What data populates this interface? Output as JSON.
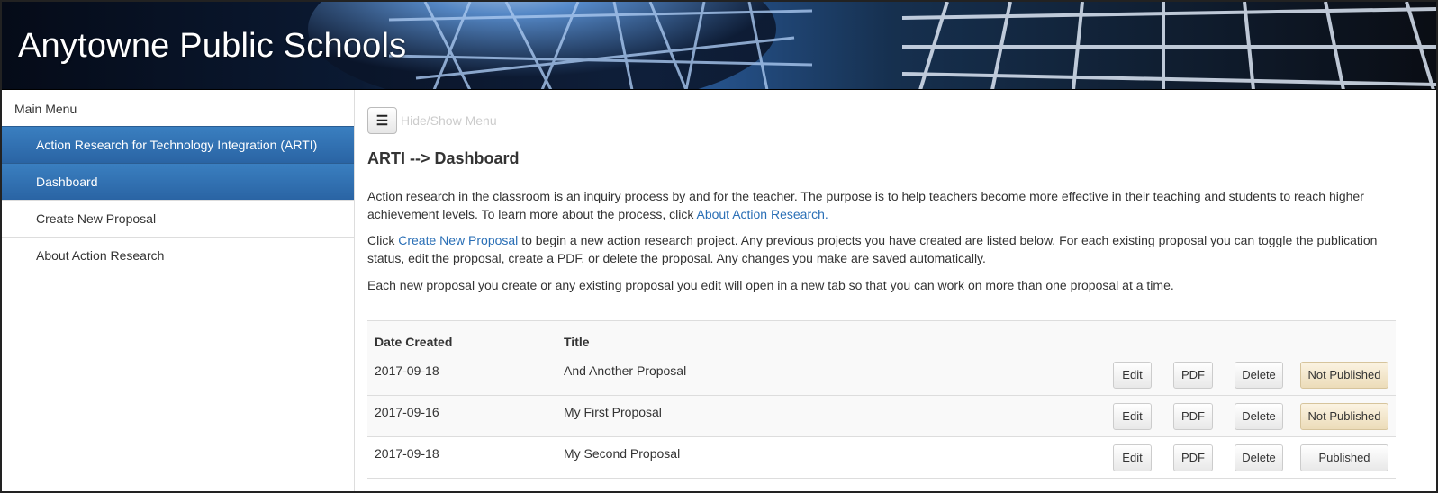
{
  "header": {
    "site_title": "Anytowne Public Schools"
  },
  "sidebar": {
    "title": "Main Menu",
    "items": [
      {
        "label": "Action Research for Technology Integration (ARTI)",
        "active": true
      },
      {
        "label": "Dashboard",
        "active": true
      },
      {
        "label": "Create New Proposal",
        "active": false
      },
      {
        "label": "About Action Research",
        "active": false
      }
    ]
  },
  "toolbar": {
    "toggle_icon": "☰",
    "toggle_label": "Hide/Show Menu"
  },
  "main": {
    "title": "ARTI --> Dashboard",
    "p1_text": "Action research in the classroom is an inquiry process by and for the teacher. The purpose is to help teachers become more effective in their teaching and students to reach higher achievement levels. To learn more about the process, click ",
    "p1_link": "About Action Research.",
    "p2_prefix": "Click ",
    "p2_link": "Create New Proposal",
    "p2_text": " to begin a new action research project. Any previous projects you have created are listed below. For each existing proposal you can toggle the publication status, edit the proposal, create a PDF, or delete the proposal. Any changes you make are saved automatically.",
    "p3_text": "Each new proposal you create or any existing proposal you edit will open in a new tab so that you can work on more than one proposal at a time."
  },
  "table": {
    "headers": {
      "date": "Date Created",
      "title": "Title"
    },
    "buttons": {
      "edit": "Edit",
      "pdf": "PDF",
      "delete": "Delete"
    },
    "rows": [
      {
        "date": "2017-09-18",
        "title": "And Another Proposal",
        "status": "Not Published"
      },
      {
        "date": "2017-09-16",
        "title": "My First Proposal",
        "status": "Not Published"
      },
      {
        "date": "2017-09-18",
        "title": "My Second Proposal",
        "status": "Published"
      }
    ]
  },
  "colors": {
    "accent": "#2a6fb6",
    "active_menu": "#2f6fb0",
    "not_published": "#f2e6c8"
  }
}
